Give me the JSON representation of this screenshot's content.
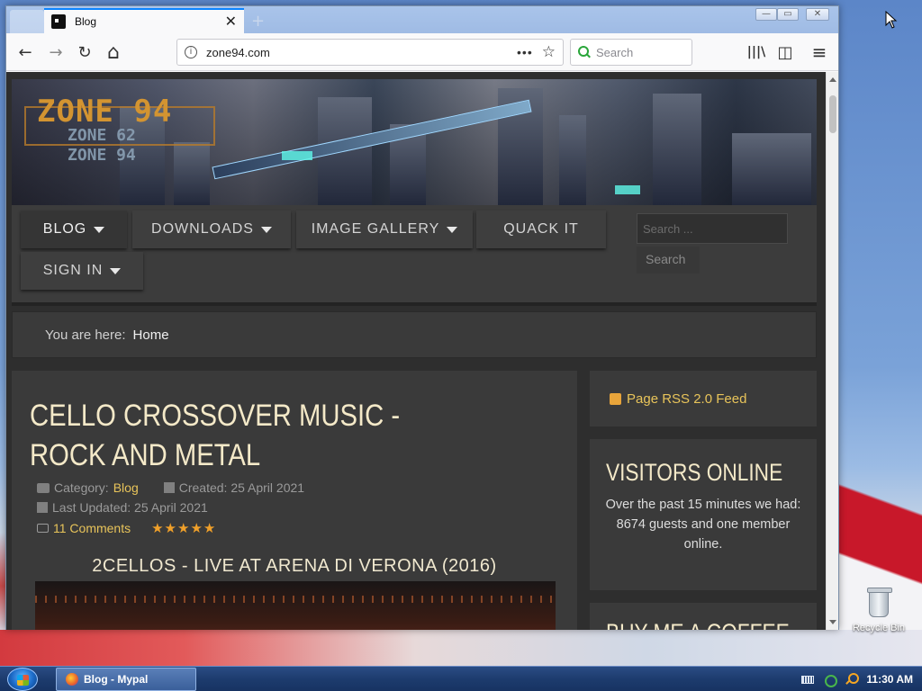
{
  "desktop": {
    "recycle_bin_label": "Recycle Bin"
  },
  "taskbar": {
    "task_label": "Blog - Mypal",
    "clock": "11:30 AM"
  },
  "browser": {
    "tab_title": "Blog",
    "tab_close": "✕",
    "new_tab": "+",
    "url": "zone94.com",
    "page_actions": "•••",
    "bookmark_star": "☆",
    "search_placeholder": "Search",
    "win_min": "—",
    "win_max": "▭",
    "win_close": "✕",
    "back": "←",
    "forward": "→",
    "reload": "↻",
    "home": "⌂",
    "library": "|||\\",
    "sidebar": "◫",
    "menu": "≡"
  },
  "site": {
    "logo_main": "ZONE 94",
    "logo_sub1": "ZONE 62",
    "logo_sub2": "ZONE 94",
    "menu": [
      {
        "label": "BLOG",
        "has_caret": true
      },
      {
        "label": "DOWNLOADS",
        "has_caret": true
      },
      {
        "label": "IMAGE GALLERY",
        "has_caret": true
      },
      {
        "label": "QUACK IT",
        "has_caret": false
      },
      {
        "label": "SIGN IN",
        "has_caret": true
      }
    ],
    "search_placeholder": "Search ...",
    "search_button": "Search",
    "breadcrumb_label": "You are here:",
    "breadcrumb_home": "Home"
  },
  "article": {
    "title": "CELLO CROSSOVER MUSIC - ROCK AND METAL",
    "category_label": "Category:",
    "category": "Blog",
    "created": "Created: 25 April 2021",
    "updated": "Last Updated: 25 April 2021",
    "comments": "11 Comments",
    "rating_stars": "★★★★★",
    "subheading": "2CELLOS - LIVE AT ARENA DI VERONA (2016)"
  },
  "sidebar": {
    "rss": "Page RSS 2.0 Feed",
    "visitors_title": "VISITORS ONLINE",
    "visitors_line1": "Over the past 15 minutes we had:",
    "visitors_line2": "8674 guests and one member online.",
    "coffee_title": "BUY ME A COFFEE"
  }
}
